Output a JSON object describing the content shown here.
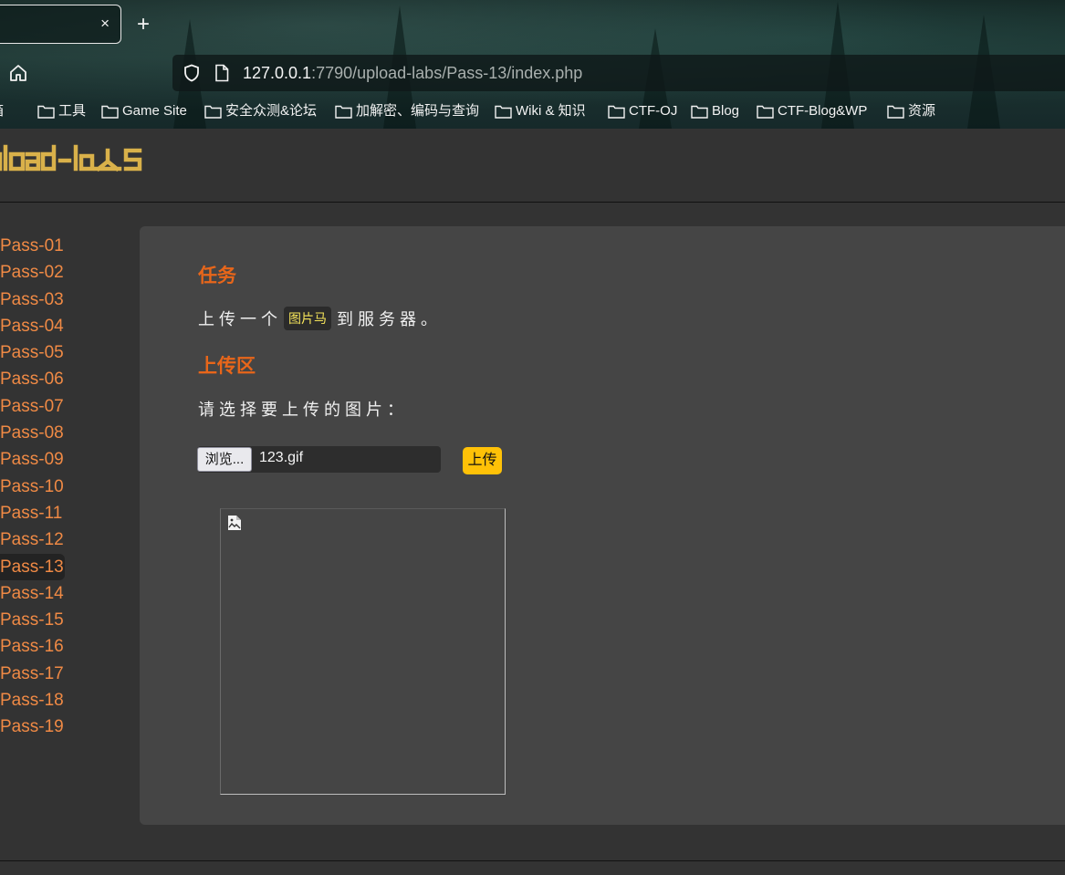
{
  "browser": {
    "tab_close": "×",
    "new_tab": "+",
    "url_host": "127.0.0.1",
    "url_path": ":7790/upload-labs/Pass-13/index.php",
    "bookmarks": [
      "邮箱",
      "工具",
      "Game Site",
      "安全众测&论坛",
      "加解密、编码与查询",
      "Wiki & 知识",
      "CTF-OJ",
      "Blog",
      "CTF-Blog&WP",
      "资源"
    ]
  },
  "header": {
    "logo_text": "upload-labs",
    "logo_color": "#d9b14a"
  },
  "sidebar": {
    "items": [
      "Pass-01",
      "Pass-02",
      "Pass-03",
      "Pass-04",
      "Pass-05",
      "Pass-06",
      "Pass-07",
      "Pass-08",
      "Pass-09",
      "Pass-10",
      "Pass-11",
      "Pass-12",
      "Pass-13",
      "Pass-14",
      "Pass-15",
      "Pass-16",
      "Pass-17",
      "Pass-18",
      "Pass-19"
    ],
    "active": "Pass-13"
  },
  "main": {
    "task_title": "任务",
    "task_before": "上传一个",
    "task_code": "图片马",
    "task_after": "到服务器。",
    "upload_title": "上传区",
    "upload_prompt": "请选择要上传的图片：",
    "browse_label": "浏览...",
    "file_name": "123.gif",
    "upload_label": "上传"
  },
  "colors": {
    "accent": "#e8661a",
    "link": "#f08a45",
    "button": "#ffc107",
    "panel": "#454545"
  }
}
